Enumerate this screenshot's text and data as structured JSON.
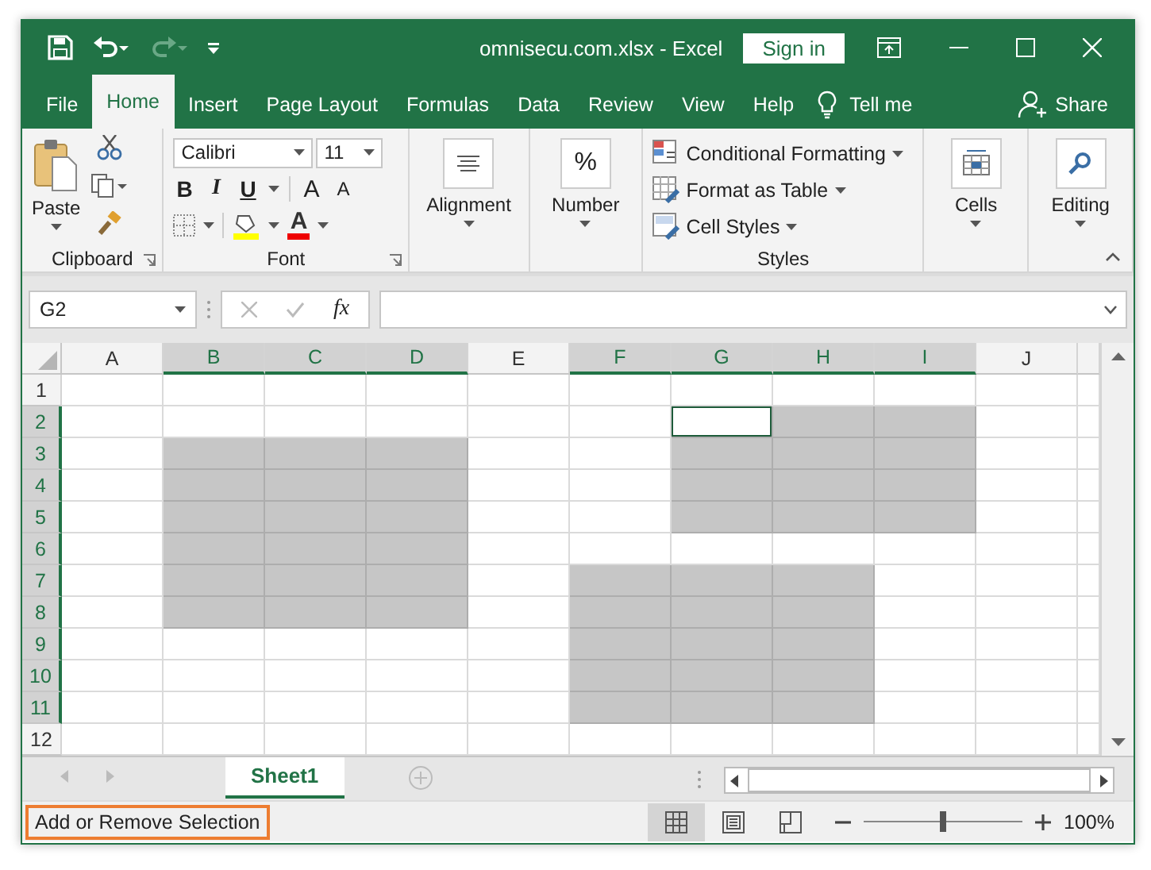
{
  "window": {
    "title": "omnisecu.com.xlsx  -  Excel",
    "sign_in": "Sign in"
  },
  "quick_access": [
    {
      "kind": "save",
      "disabled": false
    },
    {
      "kind": "undo",
      "disabled": false
    },
    {
      "kind": "redo",
      "disabled": true
    },
    {
      "kind": "customize",
      "disabled": false
    }
  ],
  "tabs": [
    {
      "label": "File",
      "selected": false
    },
    {
      "label": "Home",
      "selected": true
    },
    {
      "label": "Insert",
      "selected": false
    },
    {
      "label": "Page Layout",
      "selected": false
    },
    {
      "label": "Formulas",
      "selected": false
    },
    {
      "label": "Data",
      "selected": false
    },
    {
      "label": "Review",
      "selected": false
    },
    {
      "label": "View",
      "selected": false
    },
    {
      "label": "Help",
      "selected": false
    }
  ],
  "tell_me": "Tell me",
  "share": "Share",
  "ribbon": {
    "clipboard": {
      "label": "Clipboard",
      "paste": "Paste"
    },
    "font": {
      "label": "Font",
      "font_name": "Calibri",
      "font_size": "11",
      "bold": "B",
      "italic": "I",
      "underline": "U",
      "grow_font": "A",
      "shrink_font": "A",
      "font_color": "A"
    },
    "alignment": {
      "label": "Alignment"
    },
    "number": {
      "label": "Number",
      "symbol": "%"
    },
    "styles": {
      "label": "Styles",
      "items": [
        "Conditional Formatting",
        "Format as Table",
        "Cell Styles"
      ]
    },
    "cells": {
      "label": "Cells"
    },
    "editing": {
      "label": "Editing"
    }
  },
  "formula_bar": {
    "name_box": "G2",
    "function_label": "fx"
  },
  "sheet": {
    "columns": [
      {
        "label": "A",
        "selected": false
      },
      {
        "label": "B",
        "selected": true
      },
      {
        "label": "C",
        "selected": true
      },
      {
        "label": "D",
        "selected": true
      },
      {
        "label": "E",
        "selected": false
      },
      {
        "label": "F",
        "selected": true
      },
      {
        "label": "G",
        "selected": true
      },
      {
        "label": "H",
        "selected": true
      },
      {
        "label": "I",
        "selected": true
      },
      {
        "label": "J",
        "selected": false
      }
    ],
    "rows": [
      {
        "label": "1",
        "selected": false,
        "cells": [
          {
            "selected": false,
            "active": false
          },
          {
            "selected": false,
            "active": false
          },
          {
            "selected": false,
            "active": false
          },
          {
            "selected": false,
            "active": false
          },
          {
            "selected": false,
            "active": false
          },
          {
            "selected": false,
            "active": false
          },
          {
            "selected": false,
            "active": false
          },
          {
            "selected": false,
            "active": false
          },
          {
            "selected": false,
            "active": false
          },
          {
            "selected": false,
            "active": false
          }
        ]
      },
      {
        "label": "2",
        "selected": true,
        "cells": [
          {
            "selected": false,
            "active": false
          },
          {
            "selected": false,
            "active": false
          },
          {
            "selected": false,
            "active": false
          },
          {
            "selected": false,
            "active": false
          },
          {
            "selected": false,
            "active": false
          },
          {
            "selected": false,
            "active": false
          },
          {
            "selected": true,
            "active": true
          },
          {
            "selected": true,
            "active": false
          },
          {
            "selected": true,
            "active": false
          },
          {
            "selected": false,
            "active": false
          }
        ]
      },
      {
        "label": "3",
        "selected": true,
        "cells": [
          {
            "selected": false,
            "active": false
          },
          {
            "selected": true,
            "active": false
          },
          {
            "selected": true,
            "active": false
          },
          {
            "selected": true,
            "active": false
          },
          {
            "selected": false,
            "active": false
          },
          {
            "selected": false,
            "active": false
          },
          {
            "selected": true,
            "active": false
          },
          {
            "selected": true,
            "active": false
          },
          {
            "selected": true,
            "active": false
          },
          {
            "selected": false,
            "active": false
          }
        ]
      },
      {
        "label": "4",
        "selected": true,
        "cells": [
          {
            "selected": false,
            "active": false
          },
          {
            "selected": true,
            "active": false
          },
          {
            "selected": true,
            "active": false
          },
          {
            "selected": true,
            "active": false
          },
          {
            "selected": false,
            "active": false
          },
          {
            "selected": false,
            "active": false
          },
          {
            "selected": true,
            "active": false
          },
          {
            "selected": true,
            "active": false
          },
          {
            "selected": true,
            "active": false
          },
          {
            "selected": false,
            "active": false
          }
        ]
      },
      {
        "label": "5",
        "selected": true,
        "cells": [
          {
            "selected": false,
            "active": false
          },
          {
            "selected": true,
            "active": false
          },
          {
            "selected": true,
            "active": false
          },
          {
            "selected": true,
            "active": false
          },
          {
            "selected": false,
            "active": false
          },
          {
            "selected": false,
            "active": false
          },
          {
            "selected": true,
            "active": false
          },
          {
            "selected": true,
            "active": false
          },
          {
            "selected": true,
            "active": false
          },
          {
            "selected": false,
            "active": false
          }
        ]
      },
      {
        "label": "6",
        "selected": true,
        "cells": [
          {
            "selected": false,
            "active": false
          },
          {
            "selected": true,
            "active": false
          },
          {
            "selected": true,
            "active": false
          },
          {
            "selected": true,
            "active": false
          },
          {
            "selected": false,
            "active": false
          },
          {
            "selected": false,
            "active": false
          },
          {
            "selected": false,
            "active": false
          },
          {
            "selected": false,
            "active": false
          },
          {
            "selected": false,
            "active": false
          },
          {
            "selected": false,
            "active": false
          }
        ]
      },
      {
        "label": "7",
        "selected": true,
        "cells": [
          {
            "selected": false,
            "active": false
          },
          {
            "selected": true,
            "active": false
          },
          {
            "selected": true,
            "active": false
          },
          {
            "selected": true,
            "active": false
          },
          {
            "selected": false,
            "active": false
          },
          {
            "selected": true,
            "active": false
          },
          {
            "selected": true,
            "active": false
          },
          {
            "selected": true,
            "active": false
          },
          {
            "selected": false,
            "active": false
          },
          {
            "selected": false,
            "active": false
          }
        ]
      },
      {
        "label": "8",
        "selected": true,
        "cells": [
          {
            "selected": false,
            "active": false
          },
          {
            "selected": true,
            "active": false
          },
          {
            "selected": true,
            "active": false
          },
          {
            "selected": true,
            "active": false
          },
          {
            "selected": false,
            "active": false
          },
          {
            "selected": true,
            "active": false
          },
          {
            "selected": true,
            "active": false
          },
          {
            "selected": true,
            "active": false
          },
          {
            "selected": false,
            "active": false
          },
          {
            "selected": false,
            "active": false
          }
        ]
      },
      {
        "label": "9",
        "selected": true,
        "cells": [
          {
            "selected": false,
            "active": false
          },
          {
            "selected": false,
            "active": false
          },
          {
            "selected": false,
            "active": false
          },
          {
            "selected": false,
            "active": false
          },
          {
            "selected": false,
            "active": false
          },
          {
            "selected": true,
            "active": false
          },
          {
            "selected": true,
            "active": false
          },
          {
            "selected": true,
            "active": false
          },
          {
            "selected": false,
            "active": false
          },
          {
            "selected": false,
            "active": false
          }
        ]
      },
      {
        "label": "10",
        "selected": true,
        "cells": [
          {
            "selected": false,
            "active": false
          },
          {
            "selected": false,
            "active": false
          },
          {
            "selected": false,
            "active": false
          },
          {
            "selected": false,
            "active": false
          },
          {
            "selected": false,
            "active": false
          },
          {
            "selected": true,
            "active": false
          },
          {
            "selected": true,
            "active": false
          },
          {
            "selected": true,
            "active": false
          },
          {
            "selected": false,
            "active": false
          },
          {
            "selected": false,
            "active": false
          }
        ]
      },
      {
        "label": "11",
        "selected": true,
        "cells": [
          {
            "selected": false,
            "active": false
          },
          {
            "selected": false,
            "active": false
          },
          {
            "selected": false,
            "active": false
          },
          {
            "selected": false,
            "active": false
          },
          {
            "selected": false,
            "active": false
          },
          {
            "selected": true,
            "active": false
          },
          {
            "selected": true,
            "active": false
          },
          {
            "selected": true,
            "active": false
          },
          {
            "selected": false,
            "active": false
          },
          {
            "selected": false,
            "active": false
          }
        ]
      },
      {
        "label": "12",
        "selected": false,
        "cells": [
          {
            "selected": false,
            "active": false
          },
          {
            "selected": false,
            "active": false
          },
          {
            "selected": false,
            "active": false
          },
          {
            "selected": false,
            "active": false
          },
          {
            "selected": false,
            "active": false
          },
          {
            "selected": false,
            "active": false
          },
          {
            "selected": false,
            "active": false
          },
          {
            "selected": false,
            "active": false
          },
          {
            "selected": false,
            "active": false
          },
          {
            "selected": false,
            "active": false
          }
        ]
      }
    ]
  },
  "sheet_tabs": [
    {
      "label": "Sheet1",
      "selected": true
    }
  ],
  "status_bar": {
    "message": "Add or Remove Selection",
    "views": [
      {
        "kind": "normal",
        "selected": true
      },
      {
        "kind": "page_layout",
        "selected": false
      },
      {
        "kind": "page_break",
        "selected": false
      }
    ],
    "zoom": {
      "level": 0.5,
      "reading": "100%"
    }
  }
}
